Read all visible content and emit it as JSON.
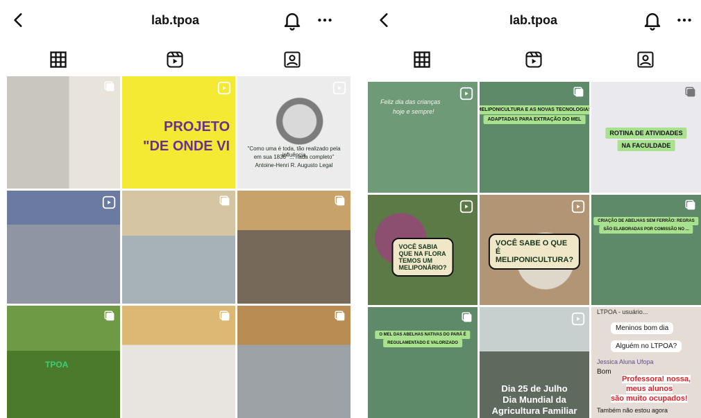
{
  "left_screen": {
    "header": {
      "title": "lab.tpoa"
    },
    "tabs": [
      {
        "name": "grid"
      },
      {
        "name": "reels"
      },
      {
        "name": "tagged"
      }
    ],
    "posts": [
      {
        "style": "poster",
        "icon": "multi"
      },
      {
        "style": "yellow",
        "icon": "reel",
        "lines": [
          "PROJETO",
          "\"DE ONDE VI"
        ]
      },
      {
        "style": "portrait",
        "icon": "reel",
        "lines": [
          "\"Como uma é toda, tão realizado pela influência",
          "em sua 1836\" ... nada completo\"",
          "Antoine-Henri R. Augusto Legal"
        ]
      },
      {
        "style": "lab1",
        "icon": "reel"
      },
      {
        "style": "lab2",
        "icon": "multi"
      },
      {
        "style": "lab3",
        "icon": "multi"
      },
      {
        "style": "outdoor",
        "icon": "multi",
        "lines": [
          "TPOA"
        ]
      },
      {
        "style": "group1",
        "icon": "multi"
      },
      {
        "style": "group2",
        "icon": "multi"
      }
    ]
  },
  "right_screen": {
    "header": {
      "title": "lab.tpoa"
    },
    "tabs": [
      {
        "name": "grid"
      },
      {
        "name": "reels"
      },
      {
        "name": "tagged"
      }
    ],
    "posts": [
      {
        "style": "green2",
        "icon": "reel",
        "lines": [
          "Feliz dia das crianças",
          "hoje e sempre!"
        ]
      },
      {
        "style": "green",
        "icon": "multi",
        "lines": [
          "MELIPONICULTURA E AS NOVAS TECNOLOGIAS",
          "ADAPTADAS PARA EXTRAÇÃO DO MEL"
        ]
      },
      {
        "style": "white",
        "icon": "multi",
        "lines": [
          "ROTINA DE ATIVIDADES",
          "NA FACULDADE"
        ]
      },
      {
        "style": "plant",
        "icon": "reel",
        "lines": [
          "VOCÊ SABIA QUE NA FLORA",
          "TEMOS UM MELIPONÁRIO?"
        ]
      },
      {
        "style": "bee",
        "icon": "reel",
        "lines": [
          "VOCÊ SABE O QUE É",
          "MELIPONICULTURA?"
        ]
      },
      {
        "style": "green",
        "icon": "multi",
        "lines": [
          "CRIAÇÃO DE ABELHAS SEM FERRÃO: REGRAS",
          "SÃO ELABORADAS POR COMISSÃO NO ..."
        ]
      },
      {
        "style": "green",
        "icon": "multi",
        "lines": [
          "O MEL DAS ABELHAS NATIVAS DO PARÁ É",
          "REGULAMENTADO E VALORIZADO"
        ]
      },
      {
        "style": "water",
        "icon": "reel",
        "lines": [
          "Dia 25 de Julho",
          "Dia Mundial da",
          "Agricultura Familiar"
        ]
      },
      {
        "style": "chat",
        "icon": "none",
        "chat": {
          "topline": "LTPOA - usuário...",
          "msg1": "Meninos bom dia",
          "msg2": "Alguém no LTPOA?",
          "sender": "Jessica Aluna Ufopa",
          "frag": "Bom",
          "red1": "Professora! nossa,",
          "red2": "meus alunos",
          "red3": "são muito ocupados!",
          "foot": "Também não estou agora"
        }
      }
    ]
  }
}
